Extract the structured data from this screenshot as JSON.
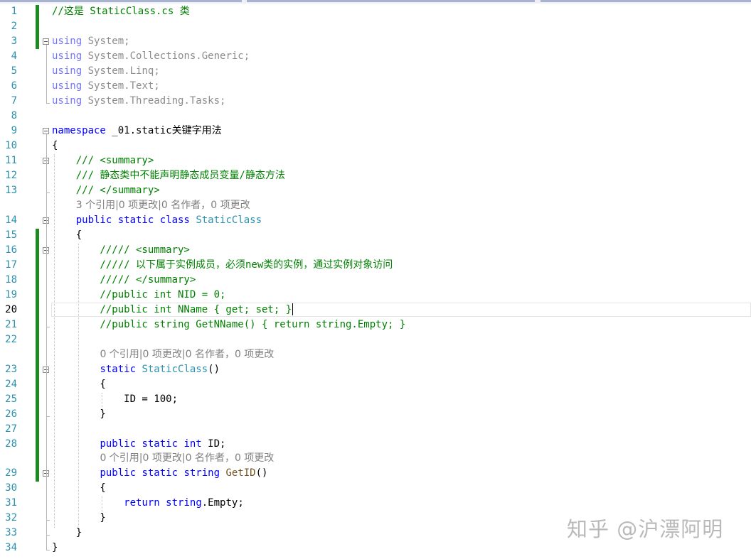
{
  "editor": {
    "active_line": 20,
    "colors": {
      "keyword": "#0000ff",
      "comment": "#008000",
      "type": "#2b91af",
      "method": "#74531f",
      "usings_dim": "#8c8c8c",
      "text": "#000000",
      "lens": "#808080",
      "line_number": "#2b91af",
      "change_bar": "#1f8a1f"
    },
    "lines": [
      {
        "n": "1",
        "tokens": [
          {
            "t": "//这是 StaticClass.cs 类",
            "c": "comment"
          }
        ]
      },
      {
        "n": "2",
        "tokens": []
      },
      {
        "n": "3",
        "tokens": [
          {
            "t": "using",
            "c": "kwdim"
          },
          {
            "t": " System;",
            "c": "dim"
          }
        ]
      },
      {
        "n": "4",
        "tokens": [
          {
            "t": "using",
            "c": "kwdim"
          },
          {
            "t": " System.Collections.Generic;",
            "c": "dim"
          }
        ]
      },
      {
        "n": "5",
        "tokens": [
          {
            "t": "using",
            "c": "kwdim"
          },
          {
            "t": " System.Linq;",
            "c": "dim"
          }
        ]
      },
      {
        "n": "6",
        "tokens": [
          {
            "t": "using",
            "c": "kwdim"
          },
          {
            "t": " System.Text;",
            "c": "dim"
          }
        ]
      },
      {
        "n": "7",
        "tokens": [
          {
            "t": "using",
            "c": "kwdim"
          },
          {
            "t": " System.Threading.Tasks;",
            "c": "dim"
          }
        ]
      },
      {
        "n": "8",
        "tokens": []
      },
      {
        "n": "9",
        "tokens": [
          {
            "t": "namespace",
            "c": "kw"
          },
          {
            "t": " _01.static关键字用法",
            "c": "text"
          }
        ]
      },
      {
        "n": "10",
        "tokens": [
          {
            "t": "{",
            "c": "text"
          }
        ]
      },
      {
        "n": "11",
        "tokens": [
          {
            "t": "    /// <summary>",
            "c": "comment"
          }
        ]
      },
      {
        "n": "12",
        "tokens": [
          {
            "t": "    /// 静态类中不能声明静态成员变量/静态方法",
            "c": "comment"
          }
        ]
      },
      {
        "n": "13",
        "tokens": [
          {
            "t": "    /// </summary>",
            "c": "comment"
          }
        ],
        "lens": "3 个引用|0 项更改|0 名作者，0 项更改"
      },
      {
        "n": "14",
        "tokens": [
          {
            "t": "    ",
            "c": "text"
          },
          {
            "t": "public static class",
            "c": "kw"
          },
          {
            "t": " ",
            "c": "text"
          },
          {
            "t": "StaticClass",
            "c": "type"
          }
        ]
      },
      {
        "n": "15",
        "tokens": [
          {
            "t": "    {",
            "c": "text"
          }
        ]
      },
      {
        "n": "16",
        "tokens": [
          {
            "t": "        ///// <summary>",
            "c": "comment"
          }
        ]
      },
      {
        "n": "17",
        "tokens": [
          {
            "t": "        ///// 以下属于实例成员，必须new类的实例，通过实例对象访问",
            "c": "comment"
          }
        ]
      },
      {
        "n": "18",
        "tokens": [
          {
            "t": "        ///// </summary>",
            "c": "comment"
          }
        ]
      },
      {
        "n": "19",
        "tokens": [
          {
            "t": "        //public int NID = 0;",
            "c": "comment"
          }
        ]
      },
      {
        "n": "20",
        "tokens": [
          {
            "t": "        //public int NName { get; set; }",
            "c": "comment"
          }
        ]
      },
      {
        "n": "21",
        "tokens": [
          {
            "t": "        //public string GetNName() { return string.Empty; }",
            "c": "comment"
          }
        ]
      },
      {
        "n": "22",
        "tokens": [],
        "lens": "0 个引用|0 项更改|0 名作者，0 项更改"
      },
      {
        "n": "23",
        "tokens": [
          {
            "t": "        ",
            "c": "text"
          },
          {
            "t": "static",
            "c": "kw"
          },
          {
            "t": " ",
            "c": "text"
          },
          {
            "t": "StaticClass",
            "c": "type"
          },
          {
            "t": "()",
            "c": "text"
          }
        ]
      },
      {
        "n": "24",
        "tokens": [
          {
            "t": "        {",
            "c": "text"
          }
        ]
      },
      {
        "n": "25",
        "tokens": [
          {
            "t": "            ID = 100;",
            "c": "text"
          }
        ]
      },
      {
        "n": "26",
        "tokens": [
          {
            "t": "        }",
            "c": "text"
          }
        ]
      },
      {
        "n": "27",
        "tokens": []
      },
      {
        "n": "28",
        "tokens": [
          {
            "t": "        ",
            "c": "text"
          },
          {
            "t": "public static int",
            "c": "kw"
          },
          {
            "t": " ID;",
            "c": "text"
          }
        ],
        "lens": "0 个引用|0 项更改|0 名作者，0 项更改"
      },
      {
        "n": "29",
        "tokens": [
          {
            "t": "        ",
            "c": "text"
          },
          {
            "t": "public static string",
            "c": "kw"
          },
          {
            "t": " ",
            "c": "text"
          },
          {
            "t": "GetID",
            "c": "method"
          },
          {
            "t": "()",
            "c": "text"
          }
        ]
      },
      {
        "n": "30",
        "tokens": [
          {
            "t": "        {",
            "c": "text"
          }
        ]
      },
      {
        "n": "31",
        "tokens": [
          {
            "t": "            ",
            "c": "text"
          },
          {
            "t": "return",
            "c": "kw"
          },
          {
            "t": " ",
            "c": "text"
          },
          {
            "t": "string",
            "c": "kw"
          },
          {
            "t": ".Empty;",
            "c": "text"
          }
        ]
      },
      {
        "n": "32",
        "tokens": [
          {
            "t": "        }",
            "c": "text"
          }
        ]
      },
      {
        "n": "33",
        "tokens": [
          {
            "t": "    }",
            "c": "text"
          }
        ]
      },
      {
        "n": "34",
        "tokens": [
          {
            "t": "}",
            "c": "text"
          }
        ]
      }
    ]
  },
  "watermark": "知乎 @沪漂阿明"
}
